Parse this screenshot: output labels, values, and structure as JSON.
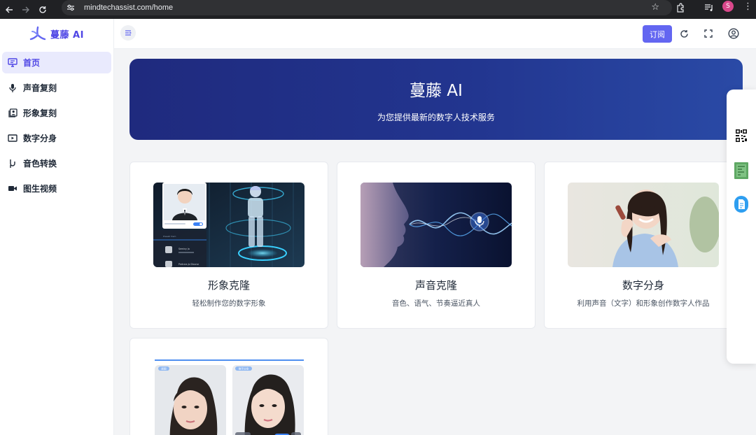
{
  "browser": {
    "url": "mindtechassist.com/home",
    "profile_initial": "S"
  },
  "brand": {
    "name": "蔓藤 AI",
    "accent": "#4f46e5"
  },
  "sidebar": {
    "items": [
      {
        "label": "首页",
        "icon": "monitor-icon",
        "active": true
      },
      {
        "label": "声音复刻",
        "icon": "microphone-icon"
      },
      {
        "label": "形象复刻",
        "icon": "portrait-icon"
      },
      {
        "label": "数字分身",
        "icon": "video-icon"
      },
      {
        "label": "音色转换",
        "icon": "voice-wave-icon"
      },
      {
        "label": "图生视频",
        "icon": "camera-icon"
      }
    ]
  },
  "header": {
    "subscribe_label": "订阅",
    "icons": [
      "refresh-icon",
      "fullscreen-icon",
      "user-icon"
    ]
  },
  "banner": {
    "title": "蔓藤 AI",
    "subtitle": "为您提供最新的数字人技术服务"
  },
  "cards": [
    {
      "title": "形象克隆",
      "desc": "轻松制作您的数字形象"
    },
    {
      "title": "声音克隆",
      "desc": "音色、语气、节奏逼近真人"
    },
    {
      "title": "数字分身",
      "desc": "利用声音（文字）和形象创作数字人作品"
    },
    {
      "title": "",
      "desc": ""
    }
  ],
  "card1_screen": {
    "row1": "Seminy Ja",
    "row2": "Pretrars Jo Dicorar",
    "section": "Presetr Item"
  },
  "card4_badges": [
    "原图",
    "数字分身"
  ],
  "float_panel": {
    "icons": [
      "qr-code-icon",
      "chip-icon",
      "document-icon"
    ]
  }
}
